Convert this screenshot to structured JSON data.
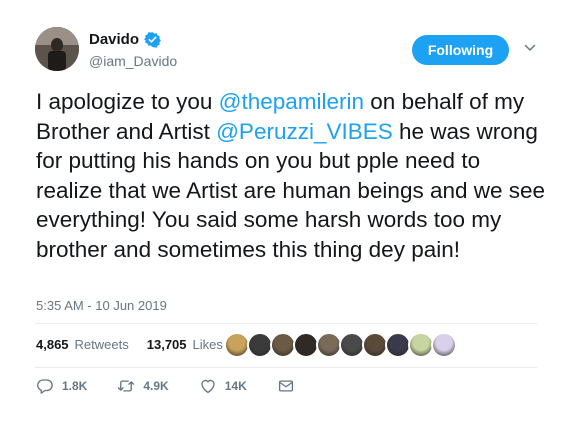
{
  "user": {
    "name": "Davido",
    "handle": "@iam_Davido"
  },
  "follow_button": "Following",
  "tweet": {
    "text_parts": [
      {
        "type": "text",
        "value": "I apologize to you "
      },
      {
        "type": "mention",
        "value": "@thepamilerin"
      },
      {
        "type": "text",
        "value": " on behalf of my Brother and Artist "
      },
      {
        "type": "mention",
        "value": "@Peruzzi_VIBES"
      },
      {
        "type": "text",
        "value": " he was wrong for putting his hands on you but pple need to realize that we Artist are human beings and we see everything! You said some harsh words too my brother and sometimes this thing dey pain!"
      }
    ],
    "timestamp": "5:35 AM - 10 Jun 2019"
  },
  "stats": {
    "retweets_count": "4,865",
    "retweets_label": "Retweets",
    "likes_count": "13,705",
    "likes_label": "Likes"
  },
  "likers_colors": [
    "#c9a35a",
    "#3b3b3b",
    "#6b5a45",
    "#2f2a26",
    "#7a6a5a",
    "#4a4a4a",
    "#5a4a3a",
    "#3a3a4a",
    "#c7d6a0",
    "#d9d1ec"
  ],
  "actions": {
    "replies": "1.8K",
    "retweets": "4.9K",
    "likes": "14K"
  },
  "colors": {
    "accent": "#1da1f2",
    "text": "#14171a",
    "muted": "#657786"
  }
}
